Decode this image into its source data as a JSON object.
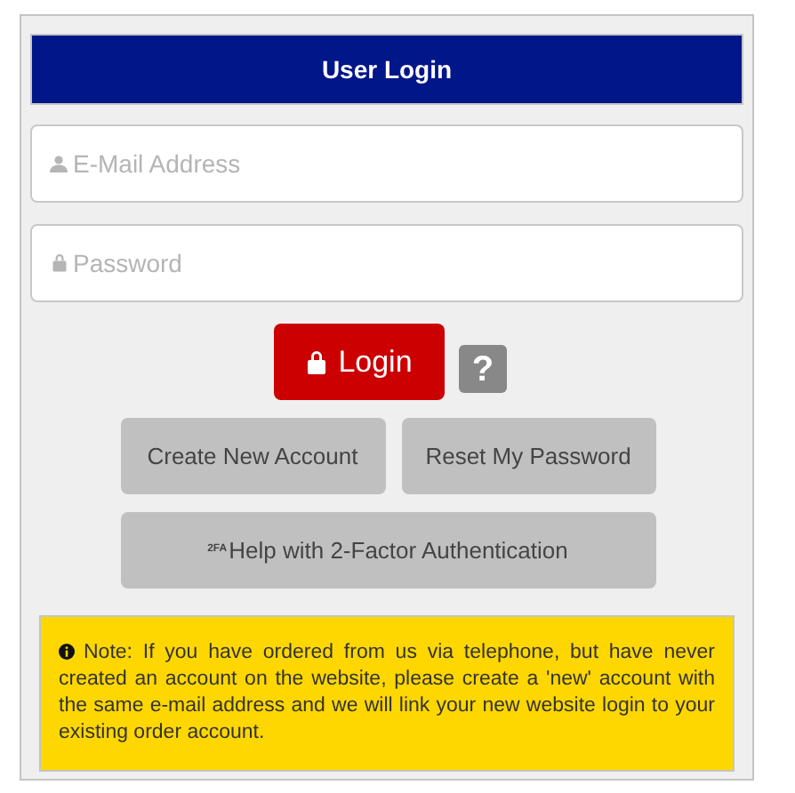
{
  "header": {
    "title": "User Login"
  },
  "email_field": {
    "placeholder": "E-Mail Address"
  },
  "password_field": {
    "placeholder": "Password"
  },
  "login_button": {
    "label": "Login"
  },
  "help_button": {
    "label": "?"
  },
  "buttons": [
    {
      "label": "Create New Account"
    },
    {
      "label": "Reset My Password"
    }
  ],
  "twofa_button": {
    "badge": "2FA",
    "label": "Help with 2-Factor Authentication"
  },
  "note": {
    "text": "Note: If you have ordered from us via telephone, but have never created an account on the website, please create a 'new' account with the same e-mail address and we will link your new website login to your existing order account."
  }
}
